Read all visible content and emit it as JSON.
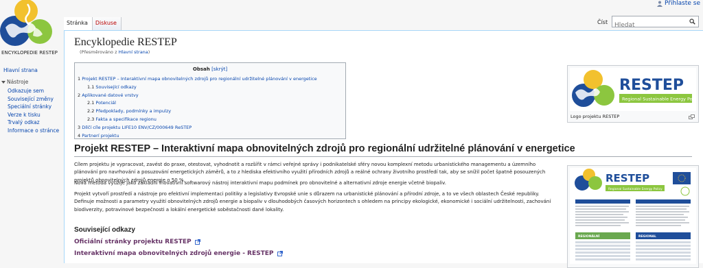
{
  "site": {
    "logo_caption": "ENCYKLOPEDIE RESTEP"
  },
  "personal": {
    "login": "Přihlaste se"
  },
  "tabs": {
    "page": "Stránka",
    "discussion": "Diskuse",
    "read": "Číst"
  },
  "search": {
    "placeholder": "Hledat"
  },
  "sidebar": {
    "main_page": "Hlavní strana",
    "tools_label": "Nástroje",
    "tools": [
      "Odkazuje sem",
      "Související změny",
      "Speciální stránky",
      "Verze k tisku",
      "Trvalý odkaz",
      "Informace o stránce"
    ]
  },
  "page": {
    "title": "Encyklopedie RESTEP",
    "redirect_prefix": "(Přesměrováno z",
    "redirect_link": "Hlavní strana",
    "redirect_suffix": ")"
  },
  "toc": {
    "title": "Obsah",
    "toggle": "[skrýt]",
    "items": [
      {
        "num": "1",
        "text": "Projekt RESTEP – Interaktivní mapa obnovitelných zdrojů pro regionální udržitelné plánování v energetice",
        "level": 1
      },
      {
        "num": "1.1",
        "text": "Související odkazy",
        "level": 2
      },
      {
        "num": "2",
        "text": "Aplikované datové vrstvy",
        "level": 1
      },
      {
        "num": "2.1",
        "text": "Potenciál",
        "level": 2
      },
      {
        "num": "2.2",
        "text": "Předpoklady, podmínky a impulzy",
        "level": 2
      },
      {
        "num": "2.3",
        "text": "Fakta a specifikace regionu",
        "level": 2
      },
      {
        "num": "3",
        "text": "Dílčí cíle projektu LIFE10 ENV/CZ/000649 ReSTEP",
        "level": 1
      },
      {
        "num": "4",
        "text": "Partnerí projektu",
        "level": 1
      }
    ]
  },
  "thumb_logo": {
    "brand": "RESTEP",
    "tagline": "Regional Sustainable Energy Policy",
    "caption": "Logo projektu RESTEP"
  },
  "section1": {
    "heading": "Projekt RESTEP – Interaktivní mapa obnovitelných zdrojů pro regionální udržitelné plánování v energetice",
    "p1": "Cílem projektu je vypracovat, zavést do praxe, otestovat, vyhodnotit a rozšířit v rámci veřejné správy i podnikatelské sféry novou komplexní metodu urbanistického managementu a územního plánování pro navrhování a posuzování energetických záměrů, a to z hlediska efektivního využití přírodních zdrojů a reálné ochrany životního prostředí tak, aby se snížil počet špatně posouzených projektů obnovitelných zdrojů energie o 50 %.",
    "p2": "Nová metoda využije jako základní inovativní softwarový nástroj interaktivní mapu podmínek pro obnovitelné a alternativní zdroje energie včetně biopaliv.",
    "p3": "Projekt vytvoří prostředí a nástroje pro efektivní implementaci politiky a legislativy Evropské unie s důrazem na urbanistické plánování a přírodní zdroje, a to ve všech oblastech České republiky. Definuje možnosti a parametry využití obnovitelných zdrojů energie a biopaliv v dlouhodobých časových horizontech s ohledem na principy ekologické, ekonomické i sociální udržitelnosti, zachování biodiverzity, potravinové bezpečnosti a lokální energetické soběstačnosti dané lokality."
  },
  "section2": {
    "heading": "Související odkazy",
    "links": [
      "Oficiální stránky projektu RESTEP",
      "Interaktivní mapa obnovitelných zdrojů energie - RESTEP"
    ]
  },
  "poster": {
    "brand": "RESTEP",
    "tagline": "Regional Sustainable Energy Policy",
    "col1": "REGIONÁLNÍ",
    "col2": "REGIONAL"
  },
  "colors": {
    "link": "#0645ad",
    "visited": "#663366",
    "brand_blue": "#1f4e9a",
    "brand_yellow": "#f2c12e",
    "brand_green": "#8cc63f"
  }
}
